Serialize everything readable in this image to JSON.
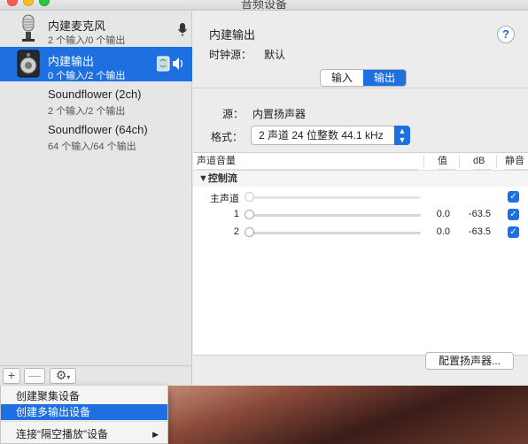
{
  "window": {
    "title": "音频设备"
  },
  "sidebar": {
    "devices": [
      {
        "name": "内建麦克风",
        "sub": "2 个输入/0 个输出",
        "icon": "microphone-icon",
        "right_icon": "microphone-icon",
        "selected": false
      },
      {
        "name": "内建输出",
        "sub": "0 个输入/2 个输出",
        "icon": "speaker-icon",
        "right_icon": "speaker-icon",
        "selected": true
      },
      {
        "name": "Soundflower (2ch)",
        "sub": "2 个输入/2 个输出",
        "icon": "",
        "selected": false
      },
      {
        "name": "Soundflower (64ch)",
        "sub": "64 个输入/64 个输出",
        "icon": "",
        "selected": false
      }
    ],
    "footer": {
      "add": "+",
      "remove": "—",
      "gear": "⚙"
    }
  },
  "main": {
    "device_title": "内建输出",
    "clock_label": "时钟源：",
    "clock_value": "默认",
    "help": "?",
    "tabs": [
      {
        "label": "输入",
        "active": false
      },
      {
        "label": "输出",
        "active": true
      }
    ],
    "source_label": "源：",
    "source_value": "内置扬声器",
    "format_label": "格式：",
    "format_value": "2 声道 24 位整数 44.1 kHz",
    "table": {
      "headers": {
        "volume": "声道音量",
        "value": "值",
        "db": "dB",
        "mute": "静音"
      },
      "group": "▼控制流",
      "rows": [
        {
          "label": "主声道",
          "value": "",
          "db": "",
          "muted": true
        },
        {
          "label": "1",
          "value": "0.0",
          "db": "-63.5",
          "muted": true
        },
        {
          "label": "2",
          "value": "0.0",
          "db": "-63.5",
          "muted": true
        }
      ]
    },
    "config_button": "配置扬声器..."
  },
  "menu": {
    "items": [
      {
        "label": "创建聚集设备",
        "highlighted": false
      },
      {
        "label": "创建多输出设备",
        "highlighted": true
      },
      {
        "label": "连接“隔空播放”设备",
        "highlighted": false,
        "submenu": true
      }
    ]
  }
}
